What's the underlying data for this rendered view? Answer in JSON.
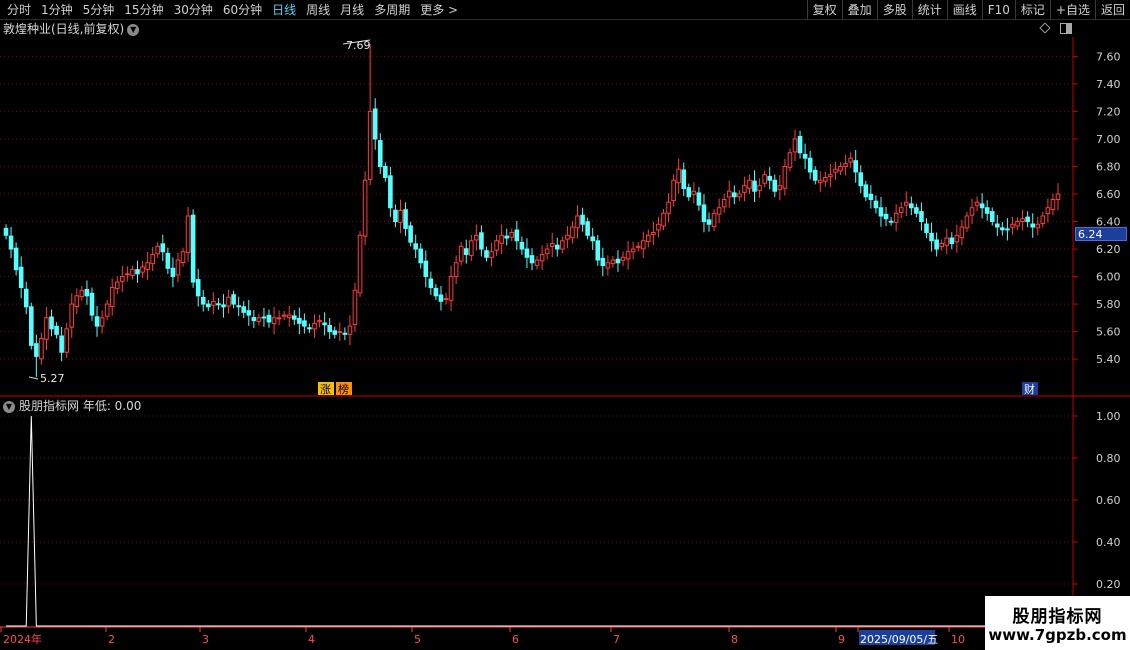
{
  "toolbar": {
    "periods": [
      {
        "label": "分时",
        "active": false
      },
      {
        "label": "1分钟",
        "active": false
      },
      {
        "label": "5分钟",
        "active": false
      },
      {
        "label": "15分钟",
        "active": false
      },
      {
        "label": "30分钟",
        "active": false
      },
      {
        "label": "60分钟",
        "active": false
      },
      {
        "label": "日线",
        "active": true
      },
      {
        "label": "周线",
        "active": false
      },
      {
        "label": "月线",
        "active": false
      },
      {
        "label": "多周期",
        "active": false
      },
      {
        "label": "更多 >",
        "active": false
      }
    ],
    "tools": [
      "复权",
      "叠加",
      "多股",
      "统计",
      "画线",
      "F10",
      "标记",
      "+自选",
      "返回"
    ]
  },
  "chart_title": "敦煌种业(日线,前复权)",
  "indicator_title": "股朋指标网  年低: 0.00",
  "last_price_tag": "6.24",
  "markers": {
    "zhang": "涨",
    "bang": "榜",
    "cai": "财"
  },
  "watermark": {
    "line1": "股朋指标网",
    "line2": "www.7gpzb.com"
  },
  "colors": {
    "up": "#ff3c3c",
    "down": "#54ffff",
    "grid": "#7a0000",
    "axis": "#c00000",
    "price_tag_bg": "#1c3e9c"
  },
  "chart_data": [
    {
      "type": "candlestick",
      "y_axis_labels": [
        "7.60",
        "7.40",
        "7.20",
        "7.00",
        "6.80",
        "6.60",
        "6.40",
        "6.20",
        "6.00",
        "5.80",
        "5.60",
        "5.40"
      ],
      "ylim": [
        5.27,
        7.69
      ],
      "high_annotation": "7.69",
      "low_annotation": "5.27",
      "x_axis_labels": [
        "2024年",
        "2",
        "3",
        "4",
        "5",
        "6",
        "7",
        "8",
        "9",
        "2025/09/05/五",
        "10"
      ],
      "approx_closes": [
        6.3,
        6.2,
        6.05,
        5.92,
        5.78,
        5.5,
        5.42,
        5.55,
        5.7,
        5.62,
        5.58,
        5.45,
        5.62,
        5.8,
        5.86,
        5.9,
        5.86,
        5.72,
        5.64,
        5.7,
        5.8,
        5.92,
        5.96,
        6.0,
        6.02,
        6.05,
        6.02,
        6.07,
        6.1,
        6.16,
        6.22,
        6.18,
        6.06,
        6.0,
        6.12,
        6.18,
        6.44,
        5.96,
        5.86,
        5.8,
        5.78,
        5.82,
        5.8,
        5.78,
        5.85,
        5.8,
        5.78,
        5.74,
        5.72,
        5.68,
        5.7,
        5.7,
        5.67,
        5.7,
        5.7,
        5.72,
        5.72,
        5.69,
        5.66,
        5.64,
        5.62,
        5.66,
        5.68,
        5.65,
        5.6,
        5.58,
        5.6,
        5.58,
        5.64,
        5.9,
        6.3,
        6.7,
        7.2,
        7.0,
        6.8,
        6.72,
        6.5,
        6.4,
        6.48,
        6.35,
        6.25,
        6.2,
        6.1,
        6.0,
        5.92,
        5.86,
        5.82,
        5.84,
        6.0,
        6.1,
        6.22,
        6.16,
        6.26,
        6.3,
        6.2,
        6.14,
        6.18,
        6.26,
        6.3,
        6.28,
        6.32,
        6.26,
        6.2,
        6.14,
        6.1,
        6.12,
        6.16,
        6.2,
        6.24,
        6.2,
        6.26,
        6.3,
        6.36,
        6.44,
        6.38,
        6.3,
        6.26,
        6.12,
        6.08,
        6.1,
        6.12,
        6.1,
        6.14,
        6.18,
        6.2,
        6.22,
        6.26,
        6.3,
        6.32,
        6.38,
        6.46,
        6.54,
        6.7,
        6.78,
        6.64,
        6.58,
        6.62,
        6.52,
        6.4,
        6.38,
        6.46,
        6.5,
        6.56,
        6.62,
        6.58,
        6.6,
        6.66,
        6.7,
        6.62,
        6.66,
        6.74,
        6.7,
        6.62,
        6.66,
        6.8,
        6.9,
        7.0,
        6.9,
        6.86,
        6.76,
        6.7,
        6.7,
        6.72,
        6.74,
        6.78,
        6.8,
        6.82,
        6.86,
        6.76,
        6.66,
        6.58,
        6.56,
        6.5,
        6.44,
        6.42,
        6.4,
        6.46,
        6.5,
        6.54,
        6.5,
        6.46,
        6.4,
        6.32,
        6.26,
        6.2,
        6.24,
        6.28,
        6.24,
        6.3,
        6.36,
        6.44,
        6.5,
        6.54,
        6.5,
        6.46,
        6.4,
        6.36,
        6.34,
        6.34,
        6.38,
        6.4,
        6.42,
        6.4,
        6.36,
        6.38,
        6.44,
        6.5,
        6.56,
        6.6
      ]
    },
    {
      "type": "line",
      "name": "年低",
      "y_axis_labels": [
        "1.00",
        "0.80",
        "0.60",
        "0.40",
        "0.20"
      ],
      "ylim": [
        0,
        1
      ],
      "spike_index": 5
    }
  ]
}
